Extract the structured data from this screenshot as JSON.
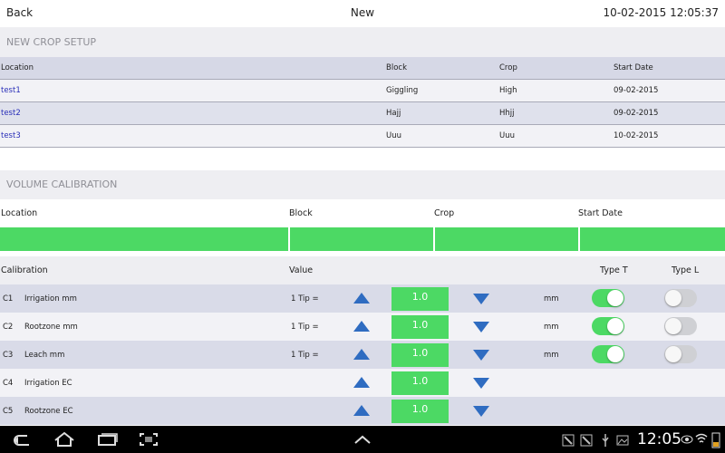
{
  "header": {
    "back_label": "Back",
    "title": "New",
    "datetime": "10-02-2015 12:05:37"
  },
  "crop_setup": {
    "section_title": "NEW CROP SETUP",
    "columns": [
      "Location",
      "Block",
      "Crop",
      "Start Date"
    ],
    "rows": [
      {
        "location": "test1",
        "block": "Giggling",
        "crop": "High",
        "start_date": "09-02-2015"
      },
      {
        "location": "test2",
        "block": "Hajj",
        "crop": "Hhjj",
        "start_date": "09-02-2015"
      },
      {
        "location": "test3",
        "block": "Uuu",
        "crop": "Uuu",
        "start_date": "10-02-2015"
      }
    ]
  },
  "volume_calibration": {
    "section_title": "VOLUME CALIBRATION",
    "columns": [
      "Location",
      "Block",
      "Crop",
      "Start Date"
    ],
    "calib_columns": [
      "Calibration",
      "Value",
      "Type T",
      "Type L"
    ],
    "rows": [
      {
        "code": "C1",
        "name": "Irrigation mm",
        "tip": "1 Tip =",
        "value": "1.0",
        "unit": "mm",
        "type_t": true,
        "type_l": false
      },
      {
        "code": "C2",
        "name": "Rootzone mm",
        "tip": "1 Tip =",
        "value": "1.0",
        "unit": "mm",
        "type_t": true,
        "type_l": false
      },
      {
        "code": "C3",
        "name": "Leach mm",
        "tip": "1 Tip =",
        "value": "1.0",
        "unit": "mm",
        "type_t": true,
        "type_l": false
      },
      {
        "code": "C4",
        "name": "Irrigation EC",
        "tip": "",
        "value": "1.0",
        "unit": "",
        "type_t": null,
        "type_l": null
      },
      {
        "code": "C5",
        "name": "Rootzone EC",
        "tip": "",
        "value": "1.0",
        "unit": "",
        "type_t": null,
        "type_l": null
      }
    ]
  },
  "status_bar": {
    "clock": "12:05"
  },
  "colors": {
    "accent_green": "#4cd964",
    "arrow_blue": "#2f6cc1",
    "link_blue": "#2a2fb8"
  }
}
